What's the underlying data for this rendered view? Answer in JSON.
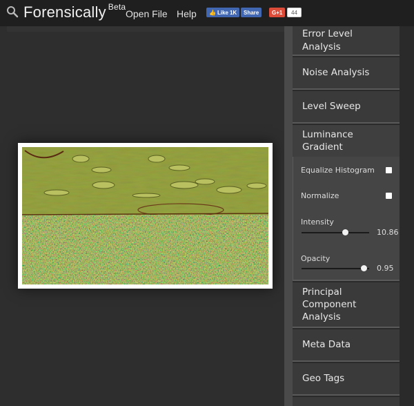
{
  "header": {
    "app_title": "Forensically",
    "app_title_sup": "Beta",
    "nav": [
      "Open File",
      "Help"
    ],
    "fb_like_label": "Like",
    "fb_like_count": "1K",
    "fb_share_label": "Share",
    "gplus_label": "G+1",
    "gplus_count": "44"
  },
  "tools": [
    {
      "label": "Error Level Analysis"
    },
    {
      "label": "Noise Analysis"
    },
    {
      "label": "Level Sweep"
    },
    {
      "label": "Luminance Gradient",
      "active": true
    },
    {
      "label": "Principal Component Analysis"
    },
    {
      "label": "Meta Data"
    },
    {
      "label": "Geo Tags"
    }
  ],
  "luminance_panel": {
    "equalize_label": "Equalize Histogram",
    "equalize_checked": false,
    "normalize_label": "Normalize",
    "normalize_checked": false,
    "intensity_label": "Intensity",
    "intensity_value": "10.86",
    "intensity_fraction": 0.64,
    "opacity_label": "Opacity",
    "opacity_value": "0.95",
    "opacity_fraction": 0.92
  },
  "colors": {
    "header_bg": "#1f1f1f",
    "sidebar_bg": "#3a3a3a",
    "fb_blue": "#4267b2",
    "gplus_red": "#dd4b39",
    "gradient_green": "#8a9a3a"
  }
}
